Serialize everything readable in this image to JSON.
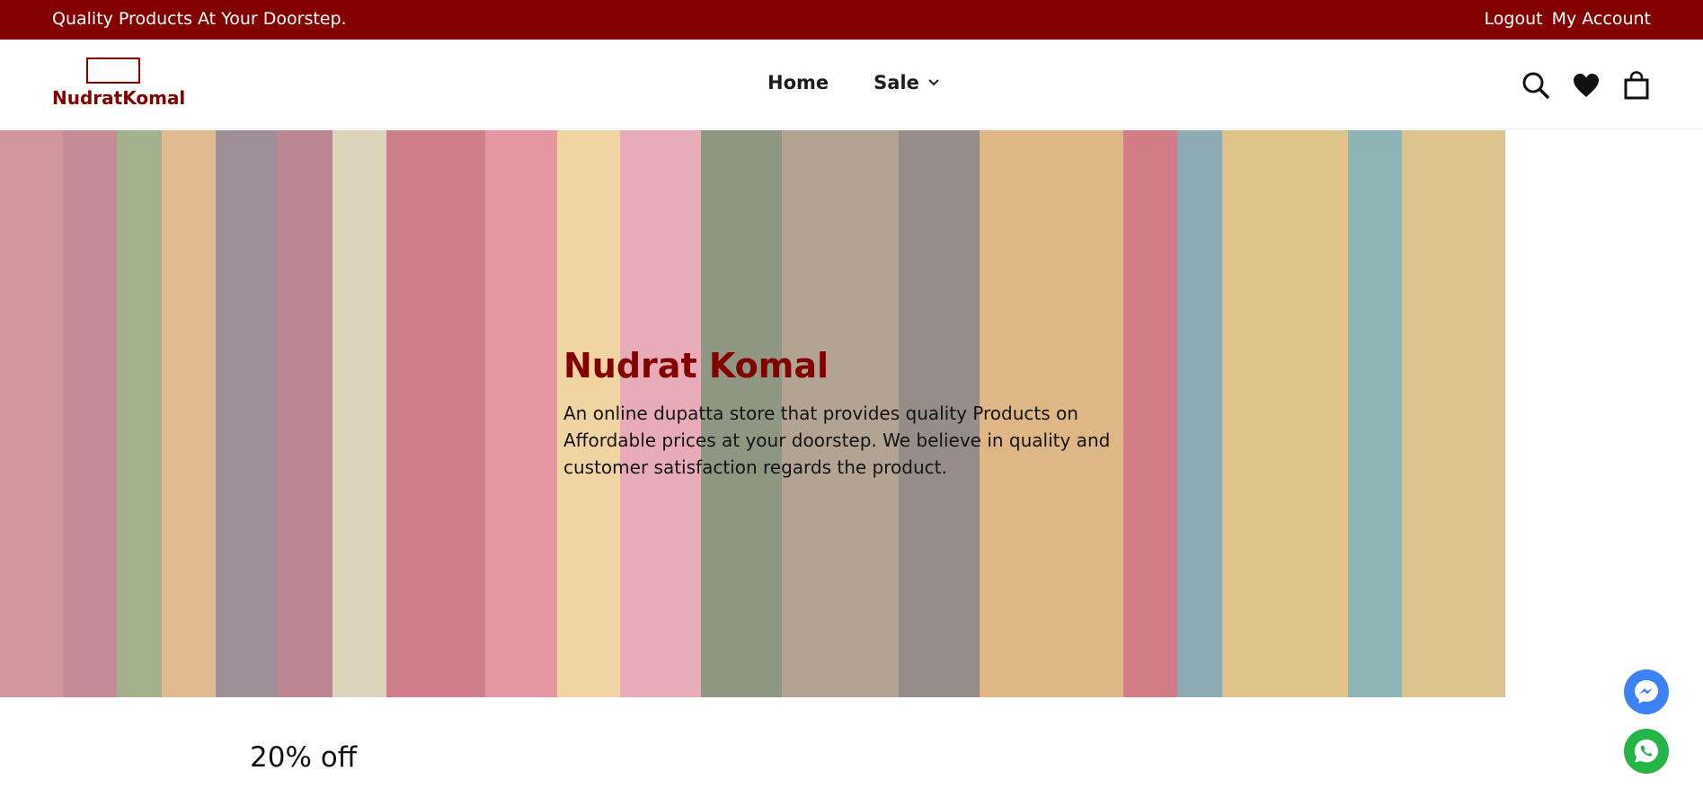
{
  "topbar": {
    "tagline": "Quality Products At Your Doorstep.",
    "links": [
      "Logout",
      "My Account"
    ]
  },
  "logo": {
    "text": "NudratKomal"
  },
  "nav": {
    "items": [
      {
        "label": "Home",
        "icon": ""
      },
      {
        "label": "Sale",
        "icon": "chevron-down-icon"
      }
    ]
  },
  "header_icons": [
    "search-icon",
    "heart-icon",
    "shopping-bag-icon"
  ],
  "hero": {
    "title": "Nudrat Komal",
    "description": "An online dupatta store that provides quality Products on Affordable prices at your doorstep. We believe in quality and customer satisfaction regards the product."
  },
  "section": {
    "title": "20% off"
  },
  "floating_buttons": [
    "messenger-icon",
    "whatsapp-icon"
  ],
  "colors": {
    "brand": "#820000",
    "messenger": "#3b82f6",
    "whatsapp": "#25b446"
  }
}
